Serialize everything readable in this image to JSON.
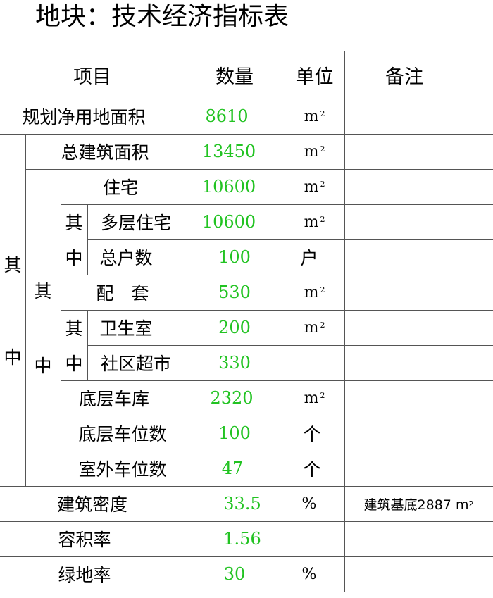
{
  "title": "地块：技术经济指标表",
  "headers": {
    "item": "项目",
    "quantity": "数量",
    "unit": "单位",
    "note": "备注"
  },
  "labels": {
    "qizhong": [
      "其",
      "中"
    ],
    "planned_area": "规划净用地面积",
    "total_floor_area": "总建筑面积",
    "residential": "住宅",
    "multistory_residential": "多层住宅",
    "households": "总户数",
    "facilities": "配　套",
    "clinic": "卫生室",
    "supermarket": "社区超市",
    "ground_garage": "底层车库",
    "ground_parking": "底层车位数",
    "outdoor_parking": "室外车位数",
    "building_density": "建筑密度",
    "far": "容积率",
    "green_rate": "绿地率"
  },
  "values": {
    "planned_area": "8610",
    "total_floor_area": "13450",
    "residential": "10600",
    "multistory_residential": "10600",
    "households": "100",
    "facilities": "530",
    "clinic": "200",
    "supermarket": "330",
    "ground_garage": "2320",
    "ground_parking": "100",
    "outdoor_parking": "47",
    "building_density": "33.5",
    "far": "1.56",
    "green_rate": "30"
  },
  "units": {
    "sqm": "m",
    "sqm_sup": "2",
    "household": "户",
    "count": "个",
    "percent": "%"
  },
  "notes": {
    "building_density": "建筑基底2887 m",
    "building_density_sup": "2"
  },
  "colors": {
    "value_green": "#22c322",
    "grid": "#555555"
  }
}
